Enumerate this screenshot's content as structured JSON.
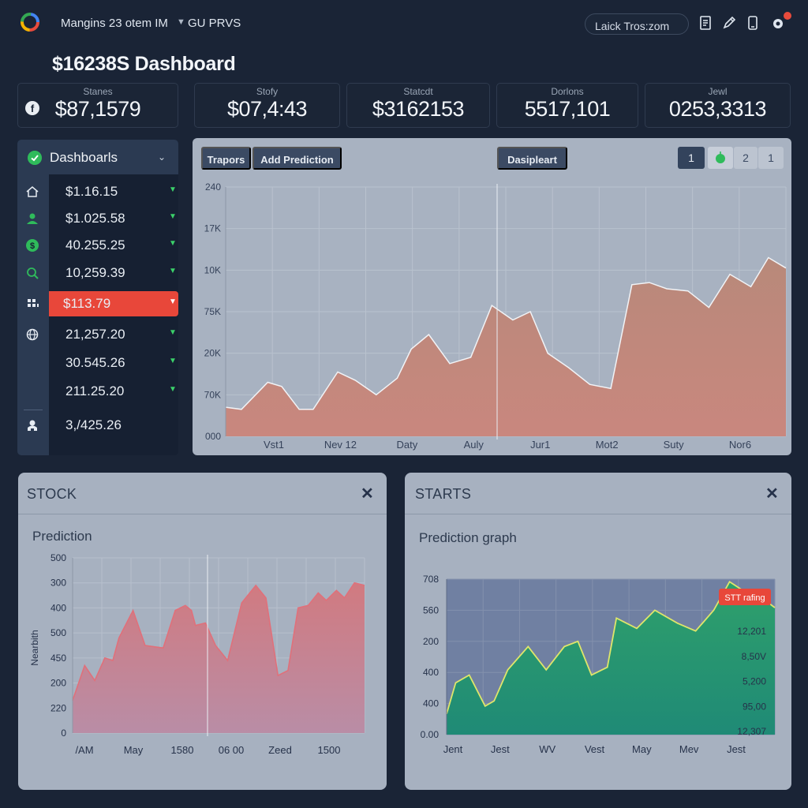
{
  "header": {
    "app_title": "Mangins 23 otem IM",
    "menu_label": "GU PRVS",
    "search_value": "Laick Tros:zom"
  },
  "page_title": "$16238S Dashboard",
  "stats": [
    {
      "label": "Stanes",
      "value": "$87,1579"
    },
    {
      "label": "Stofy",
      "value": "$07,4:43"
    },
    {
      "label": "Statcdt",
      "value": "$3162153"
    },
    {
      "label": "Dorlons",
      "value": "5517,101"
    },
    {
      "label": "Jewl",
      "value": "0253,3313"
    }
  ],
  "sidebar": {
    "title": "Dashboarls",
    "items": [
      {
        "value": "$1.16.15",
        "icon": "home-icon"
      },
      {
        "value": "$1.025.58",
        "icon": "user-icon"
      },
      {
        "value": "40.255.25",
        "icon": "dollar-icon"
      },
      {
        "value": "10,259.39",
        "icon": "search-icon"
      },
      {
        "value": "$113.79",
        "icon": "grid-icon",
        "active": true
      },
      {
        "value": "21,257.20",
        "icon": "globe-icon"
      },
      {
        "value": "30.545.26",
        "icon": ""
      },
      {
        "value": "211.25.20",
        "icon": ""
      },
      {
        "value": "3,/425.26",
        "icon": "people-icon"
      }
    ],
    "accent": "#e8473a",
    "ok_color": "#3bd16a"
  },
  "main_panel": {
    "buttons": [
      "Trapors",
      "Add Prediction",
      "Dasipleart"
    ],
    "pager": [
      "1",
      "2",
      "1"
    ]
  },
  "bottom_left": {
    "title": "STOCK",
    "subtitle": "Prediction"
  },
  "bottom_right": {
    "title": "STARTS",
    "subtitle": "Prediction graph",
    "badge": "STT rafing"
  },
  "chart_data": [
    {
      "type": "area",
      "title": "",
      "xlabel": "",
      "ylabel": "",
      "x_tick_labels": [
        "Vst1",
        "Nev 12",
        "Daty",
        "Auly",
        "Jur1",
        "Mot2",
        "Suty",
        "Nor6"
      ],
      "y_tick_labels": [
        "000",
        "70K",
        "20K",
        "75K",
        "10K",
        "17K",
        "240"
      ],
      "x": [
        0,
        0.45,
        1.2,
        1.6,
        2.1,
        2.5,
        3.2,
        3.7,
        4.3,
        4.9,
        5.3,
        5.8,
        6.4,
        7.0,
        7.6,
        8.2,
        8.7,
        9.2,
        9.8,
        10.4,
        11.0,
        11.6,
        12.1,
        12.6,
        13.2,
        13.8,
        14.4,
        15.0,
        15.5,
        16.0
      ],
      "values": [
        7.0,
        6.5,
        13.0,
        12.0,
        6.5,
        6.5,
        15.5,
        13.5,
        10.0,
        14.0,
        21.0,
        24.5,
        17.5,
        19.0,
        31.5,
        28.0,
        30.0,
        20.0,
        16.5,
        12.5,
        11.5,
        36.5,
        37.0,
        35.5,
        35.0,
        31.0,
        39.0,
        36.0,
        43.0,
        40.5
      ],
      "ylim": [
        0,
        60
      ],
      "xlim": [
        0,
        16
      ],
      "grid": true,
      "colors": {
        "fill_top": "#b8897a",
        "fill_bottom": "#c9877e",
        "line": "#f1f3f6"
      }
    },
    {
      "type": "area",
      "title": "",
      "xlabel": "",
      "ylabel": "Nearbith",
      "x_tick_labels": [
        "/AM",
        "May",
        "1580",
        "06 00",
        "Zeed",
        "1500"
      ],
      "y_tick_labels": [
        "0",
        "220",
        "200",
        "450",
        "500",
        "400",
        "300",
        "500"
      ],
      "x": [
        0,
        0.3,
        0.55,
        0.8,
        1.0,
        1.15,
        1.5,
        1.8,
        2.25,
        2.55,
        2.8,
        2.95,
        3.05,
        3.3,
        3.55,
        3.85,
        4.2,
        4.55,
        4.8,
        5.1,
        5.35,
        5.6,
        5.85,
        6.1,
        6.3,
        6.55,
        6.75,
        7.0,
        7.25
      ],
      "values": [
        1.3,
        2.7,
        2.1,
        3.0,
        2.9,
        3.8,
        4.9,
        3.5,
        3.4,
        4.9,
        5.1,
        4.9,
        4.3,
        4.4,
        3.5,
        2.9,
        5.2,
        5.9,
        5.4,
        2.3,
        2.5,
        5.0,
        5.1,
        5.6,
        5.3,
        5.7,
        5.4,
        6.0,
        5.9
      ],
      "ylim": [
        0,
        7
      ],
      "xlim": [
        0,
        7.25
      ],
      "grid": true,
      "colors": {
        "fill_top": "#d17a80",
        "fill_bottom": "#b98da6",
        "line": "#e0707a"
      }
    },
    {
      "type": "area",
      "title": "",
      "xlabel": "",
      "ylabel": "",
      "x_tick_labels": [
        "Jent",
        "Jest",
        "WV",
        "Vest",
        "May",
        "Mev",
        "Jest"
      ],
      "y_tick_labels": [
        "0.00",
        "400",
        "400",
        "200",
        "560",
        "708"
      ],
      "right_tick_labels": [
        "12,307",
        "95,00",
        "5,200",
        "8,50V",
        "12,201"
      ],
      "x": [
        0,
        0.2,
        0.5,
        0.85,
        1.05,
        1.35,
        1.8,
        2.2,
        2.6,
        2.9,
        3.2,
        3.55,
        3.75,
        4.2,
        4.6,
        5.1,
        5.5,
        5.9,
        6.25,
        6.6,
        6.95,
        7.25
      ],
      "values": [
        0.8,
        2.0,
        2.3,
        1.1,
        1.3,
        2.5,
        3.4,
        2.5,
        3.4,
        3.6,
        2.3,
        2.6,
        4.5,
        4.1,
        4.8,
        4.3,
        4.0,
        4.8,
        5.9,
        5.5,
        5.3,
        4.9
      ],
      "ylim": [
        0,
        6
      ],
      "xlim": [
        0,
        7.25
      ],
      "grid": true,
      "colors": {
        "plot_bg": "#7080a2",
        "fill_top": "#2fa06b",
        "fill_bottom": "#1f8a76",
        "line": "#dfe66a"
      }
    }
  ]
}
